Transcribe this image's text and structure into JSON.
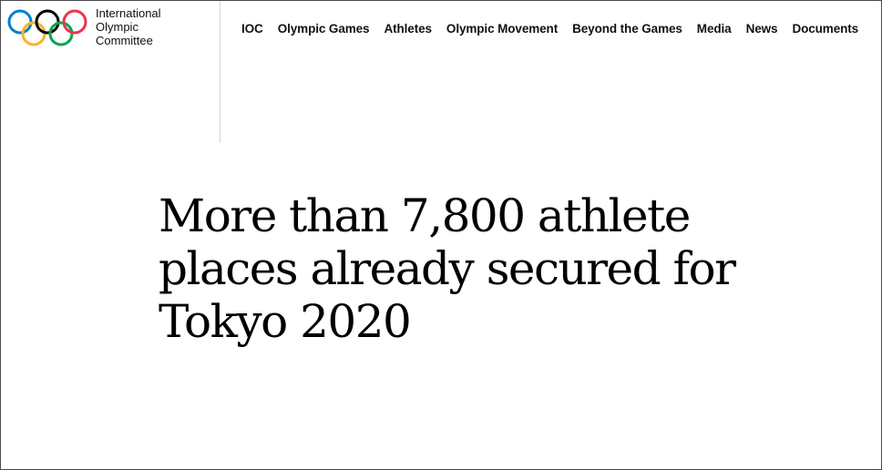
{
  "logo": {
    "line1": "International",
    "line2": "Olympic",
    "line3": "Committee",
    "colors": [
      "#0081c8",
      "#fcb131",
      "#000000",
      "#00a651",
      "#ee334e"
    ]
  },
  "nav": {
    "items": [
      {
        "label": "IOC"
      },
      {
        "label": "Olympic Games"
      },
      {
        "label": "Athletes"
      },
      {
        "label": "Olympic Movement"
      },
      {
        "label": "Beyond the Games"
      },
      {
        "label": "Media"
      },
      {
        "label": "News"
      },
      {
        "label": "Documents"
      }
    ]
  },
  "article": {
    "headline": "More than 7,800 athlete places already secured for Tokyo 2020"
  }
}
